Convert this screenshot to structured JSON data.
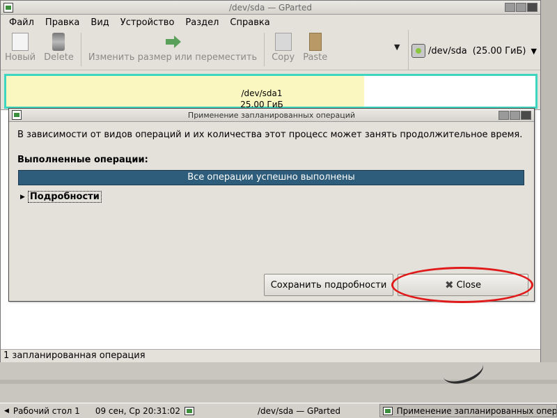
{
  "main_window": {
    "title": "/dev/sda — GParted",
    "menu": [
      "Файл",
      "Правка",
      "Вид",
      "Устройство",
      "Раздел",
      "Справка"
    ],
    "toolbar": {
      "new": "Новый",
      "delete": "Delete",
      "resize": "Изменить размер или переместить",
      "copy": "Copy",
      "paste": "Paste"
    },
    "device": {
      "name": "/dev/sda",
      "size": "(25.00 ГиБ)"
    },
    "partition": {
      "name": "/dev/sda1",
      "size": "25.00 ГиБ"
    },
    "status": "1 запланированная операция"
  },
  "dialog": {
    "title": "Применение запланированных операций",
    "message": "В зависимости от видов операций и их количества этот процесс может занять продолжительное время.",
    "heading": "Выполненные операции:",
    "progress_text": "Все операции успешно выполнены",
    "progress": 1.0,
    "details_label": "Подробности",
    "save_button": "Сохранить подробности",
    "close_button": "Close"
  },
  "taskbar": {
    "desktop": "Рабочий стол 1",
    "clock": "09 сен, Ср 20:31:02",
    "app_title": "/dev/sda — GParted",
    "task": "Применение запланированных опера"
  },
  "colors": {
    "progress": "#2d5d7a",
    "partition_border": "#3ed6c0",
    "partition_used": "#fbf7c0",
    "highlight_ellipse": "#e01a1a"
  }
}
